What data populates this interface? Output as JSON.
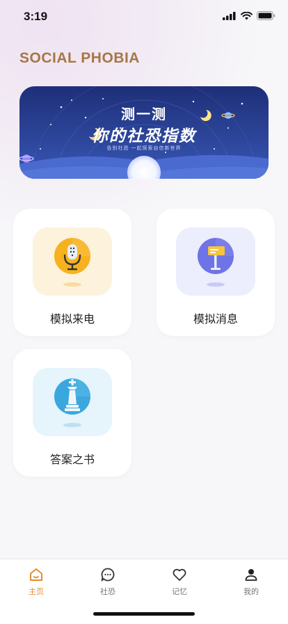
{
  "status_bar": {
    "time": "3:19"
  },
  "app_title": "SOCIAL PHOBIA",
  "banner": {
    "line1": "测一测",
    "line2": "你的社恐指数",
    "line3": "告别社恐  一起探索自信新世界"
  },
  "cards": [
    {
      "label": "模拟来电",
      "icon": "microphone-icon",
      "icon_bg": "#fdf2dc",
      "icon_color": "#f6b21e"
    },
    {
      "label": "模拟消息",
      "icon": "signpost-icon",
      "icon_bg": "#ecedfd",
      "icon_color": "#6e73e6"
    },
    {
      "label": "答案之书",
      "icon": "chess-king-icon",
      "icon_bg": "#e6f4fb",
      "icon_color": "#3aa8df"
    }
  ],
  "tabs": [
    {
      "label": "主页",
      "icon": "home-icon",
      "active": true
    },
    {
      "label": "社恐",
      "icon": "chat-icon",
      "active": false
    },
    {
      "label": "记忆",
      "icon": "heart-icon",
      "active": false
    },
    {
      "label": "我的",
      "icon": "user-icon",
      "active": false
    }
  ],
  "colors": {
    "accent": "#e58a34",
    "title": "#a87645",
    "banner_bg": "#2f4a9a"
  }
}
